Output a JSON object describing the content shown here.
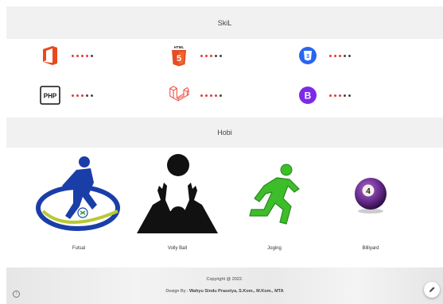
{
  "skill": {
    "title": "SkiL",
    "items": [
      {
        "name": "office-icon",
        "filled": 4,
        "total": 5
      },
      {
        "name": "html5-icon",
        "icon_text": "HTML",
        "filled": 3,
        "total": 5
      },
      {
        "name": "css3-icon",
        "filled": 3,
        "total": 5
      },
      {
        "name": "php-icon",
        "icon_text": "PHP",
        "filled": 3,
        "total": 5
      },
      {
        "name": "laravel-icon",
        "filled": 4,
        "total": 5
      },
      {
        "name": "bootstrap-icon",
        "icon_text": "B",
        "filled": 3,
        "total": 5
      }
    ],
    "dot_color_filled": "#e53935",
    "dot_color_empty": "#444444"
  },
  "hobi": {
    "title": "Hobi",
    "items": [
      {
        "label": "Futsal",
        "icon": "futsal-player-icon"
      },
      {
        "label": "Volly Ball",
        "icon": "volleyball-player-icon"
      },
      {
        "label": "Joging",
        "icon": "running-man-icon"
      },
      {
        "label": "Billiyard",
        "icon": "billiard-ball-icon",
        "ball_number": "4"
      }
    ]
  },
  "footer": {
    "copyright": "Copyright @ 2022.",
    "design_prefix": "Design By : ",
    "designer": "Wahyu Sindu Prasetya, S.Kom., M.Kom., MTA"
  },
  "colors": {
    "section_bg": "#f1f1f1",
    "office": "#e8491d",
    "html5": "#e44d26",
    "css3": "#2965f1",
    "laravel": "#ef5b4b",
    "bootstrap": "#7c2ae8",
    "futsal_blue": "#1a3ea8",
    "jog_green": "#3dbd2a",
    "billiard_purple": "#6a2c91"
  }
}
